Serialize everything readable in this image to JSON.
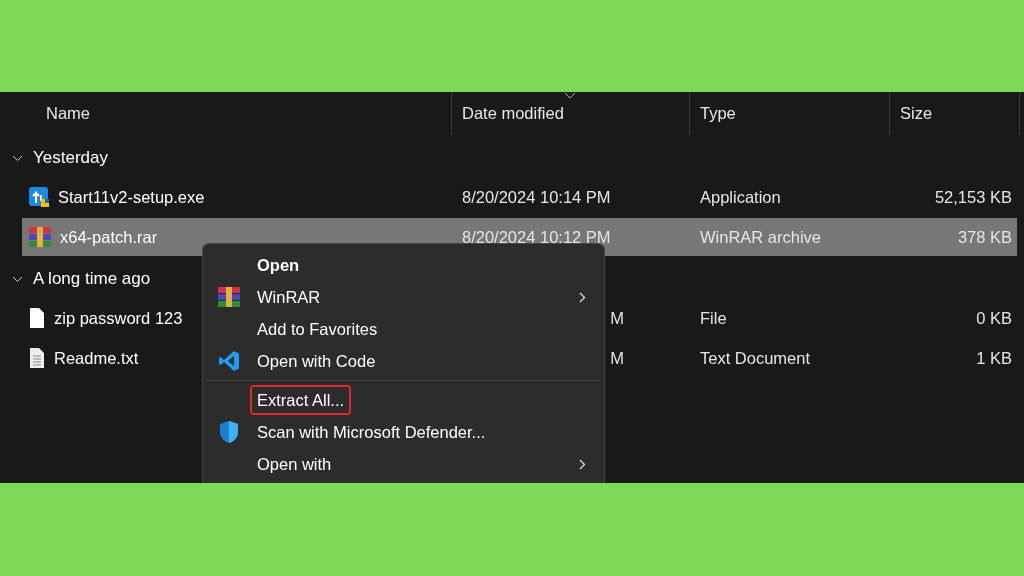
{
  "columns": [
    {
      "label": "Name",
      "sorted": false
    },
    {
      "label": "Date modified",
      "sorted": true
    },
    {
      "label": "Type",
      "sorted": false
    },
    {
      "label": "Size",
      "sorted": false
    }
  ],
  "groups": [
    {
      "label": "Yesterday",
      "expanded": true,
      "files": [
        {
          "kind": "installer",
          "name": "Start11v2-setup.exe",
          "date": "8/20/2024 10:14 PM",
          "date_cut": false,
          "type": "Application",
          "size": "52,153 KB",
          "selected": false
        },
        {
          "kind": "archive",
          "name": "x64-patch.rar",
          "date": "8/20/2024 10:12 PM",
          "date_cut": false,
          "type": "WinRAR archive",
          "size": "378 KB",
          "selected": true
        }
      ]
    },
    {
      "label": "A long time ago",
      "expanded": true,
      "files": [
        {
          "kind": "blank",
          "name": "zip password 123",
          "date": "M",
          "date_cut": true,
          "type": "File",
          "size": "0 KB",
          "selected": false
        },
        {
          "kind": "text",
          "name": "Readme.txt",
          "date": "M",
          "date_cut": true,
          "type": "Text Document",
          "size": "1 KB",
          "selected": false
        }
      ]
    }
  ],
  "context_menu": {
    "items": [
      {
        "kind": "plain",
        "label": "Open",
        "default": true,
        "submenu": false,
        "highlighted": false
      },
      {
        "kind": "archive",
        "label": "WinRAR",
        "default": false,
        "submenu": true,
        "highlighted": false
      },
      {
        "kind": "plain",
        "label": "Add to Favorites",
        "default": false,
        "submenu": false,
        "highlighted": false
      },
      {
        "kind": "code",
        "label": "Open with Code",
        "default": false,
        "submenu": false,
        "highlighted": false
      },
      {
        "kind": "separator"
      },
      {
        "kind": "plain",
        "label": "Extract All...",
        "default": false,
        "submenu": false,
        "highlighted": true
      },
      {
        "kind": "shield",
        "label": "Scan with Microsoft Defender...",
        "default": false,
        "submenu": false,
        "highlighted": false
      },
      {
        "kind": "plain",
        "label": "Open with",
        "default": false,
        "submenu": true,
        "highlighted": false
      }
    ]
  }
}
